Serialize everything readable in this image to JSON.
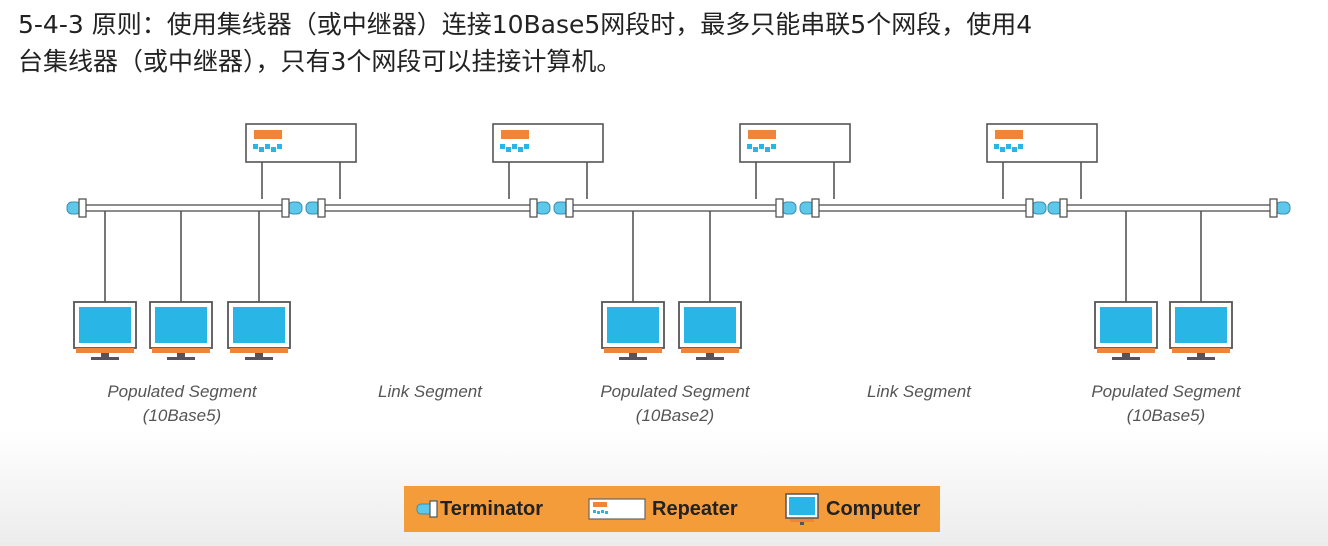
{
  "heading": {
    "line1": "5-4-3 原则：使用集线器（或中继器）连接10Base5网段时，最多只能串联5个网段，使用4",
    "line2": "台集线器（或中继器），只有3个网段可以挂接计算机。"
  },
  "segments": [
    {
      "label": "Populated Segment",
      "sub": "(10Base5)"
    },
    {
      "label": "Link Segment",
      "sub": ""
    },
    {
      "label": "Populated Segment",
      "sub": "(10Base2)"
    },
    {
      "label": "Link Segment",
      "sub": ""
    },
    {
      "label": "Populated Segment",
      "sub": "(10Base5)"
    }
  ],
  "legend": {
    "terminator": "Terminator",
    "repeater": "Repeater",
    "computer": "Computer"
  },
  "colors": {
    "screen": "#29b6e6",
    "accent": "#f0853a",
    "legend_bg": "#f59c3a",
    "terminator": "#5ec8ea",
    "line": "#555555"
  },
  "icons": {
    "terminator": "terminator-icon",
    "repeater": "repeater-icon",
    "computer": "computer-icon"
  }
}
